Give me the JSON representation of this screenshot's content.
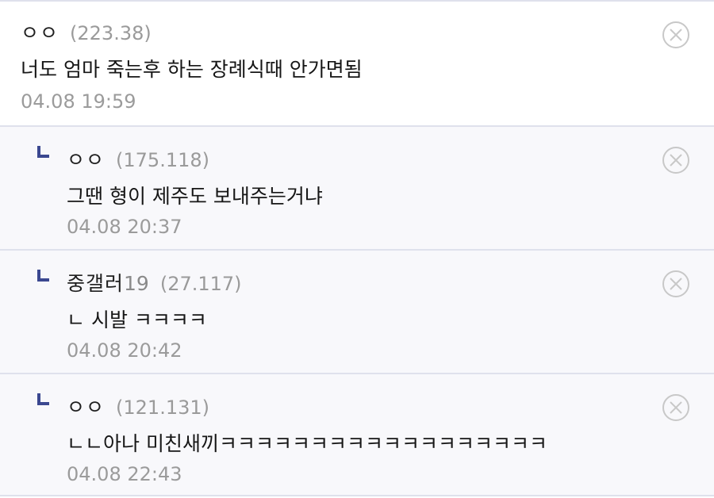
{
  "comments": [
    {
      "nick": "ㅇㅇ",
      "nick_suffix": "",
      "ip": "(223.38)",
      "text": "너도 엄마 죽는후 하는 장례식때 안가면됨",
      "date": "04.08 19:59",
      "delete_icon": "close-circle-icon"
    },
    {
      "nick": "ㅇㅇ",
      "nick_suffix": "",
      "ip": "(175.118)",
      "text": "그땐 형이 제주도 보내주는거냐",
      "date": "04.08 20:37",
      "delete_icon": "close-circle-icon"
    },
    {
      "nick": "중갤러",
      "nick_suffix": "19",
      "ip": "(27.117)",
      "text": "ㄴ 시발 ㅋㅋㅋㅋ",
      "date": "04.08 20:42",
      "delete_icon": "close-circle-icon"
    },
    {
      "nick": "ㅇㅇ",
      "nick_suffix": "",
      "ip": "(121.131)",
      "text": "ㄴㄴ아나 미친새끼ㅋㅋㅋㅋㅋㅋㅋㅋㅋㅋㅋㅋㅋㅋㅋㅋㅋㅋ",
      "date": "04.08 22:43",
      "delete_icon": "close-circle-icon"
    }
  ],
  "colors": {
    "reply_mark": "#3b4890",
    "divider": "#dfe1ec",
    "reply_bg": "#f8f8fb",
    "icon": "#c8c8c8"
  }
}
